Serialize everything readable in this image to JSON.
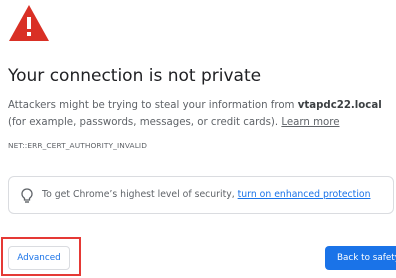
{
  "interstitial": {
    "title": "Your connection is not private",
    "description_prefix": "Attackers might be trying to steal your information from ",
    "host": "vtapdc22.local",
    "description_suffix": " (for example, passwords, messages, or credit cards). ",
    "learn_more": "Learn more",
    "error_code": "NET::ERR_CERT_AUTHORITY_INVALID",
    "warning_icon": "warning-triangle-icon",
    "warning_color": "#d93025"
  },
  "enhanced_protection": {
    "text_prefix": "To get Chrome’s highest level of security, ",
    "link": "turn on enhanced protection",
    "icon": "lightbulb-icon"
  },
  "buttons": {
    "advanced": "Advanced",
    "back_to_safety": "Back to safety",
    "primary_color": "#1a73e8",
    "highlight_color": "#e53935"
  }
}
